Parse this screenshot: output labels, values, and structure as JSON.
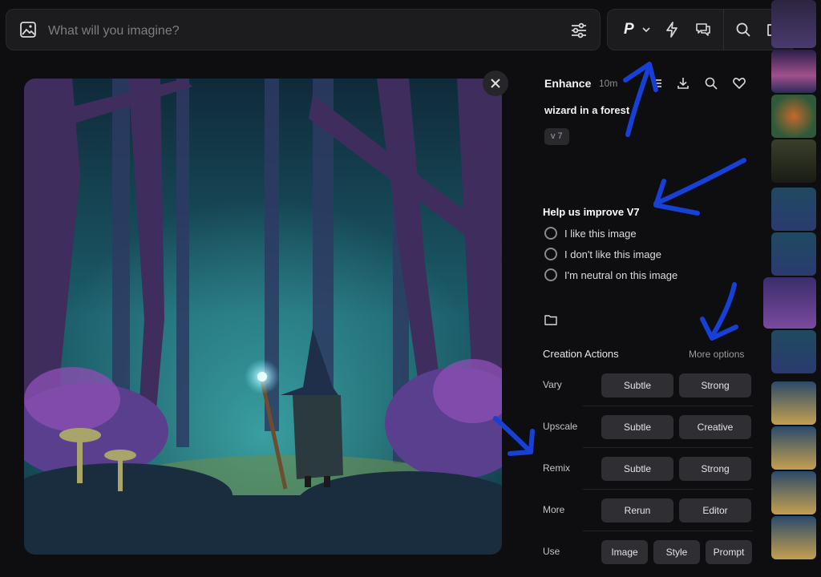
{
  "search": {
    "placeholder": "What will you imagine?"
  },
  "toolbar": {
    "model_label": "P"
  },
  "detail": {
    "title": "Enhance",
    "time": "10m",
    "prompt": "wizard in a forest",
    "version": "v 7"
  },
  "feedback": {
    "title": "Help us improve V7",
    "options": [
      "I like this image",
      "I don't like this image",
      "I'm neutral on this image"
    ]
  },
  "creation": {
    "title": "Creation Actions",
    "more_options": "More options",
    "rows": [
      {
        "label": "Vary",
        "buttons": [
          "Subtle",
          "Strong"
        ]
      },
      {
        "label": "Upscale",
        "buttons": [
          "Subtle",
          "Creative"
        ]
      },
      {
        "label": "Remix",
        "buttons": [
          "Subtle",
          "Strong"
        ]
      },
      {
        "label": "More",
        "buttons": [
          "Rerun",
          "Editor"
        ]
      },
      {
        "label": "Use",
        "buttons": [
          "Image",
          "Style",
          "Prompt"
        ]
      }
    ]
  },
  "colors": {
    "background": "#0e0e10",
    "panel": "#1c1c1f",
    "button": "#2e2e33",
    "annotation": "#1640d6"
  }
}
